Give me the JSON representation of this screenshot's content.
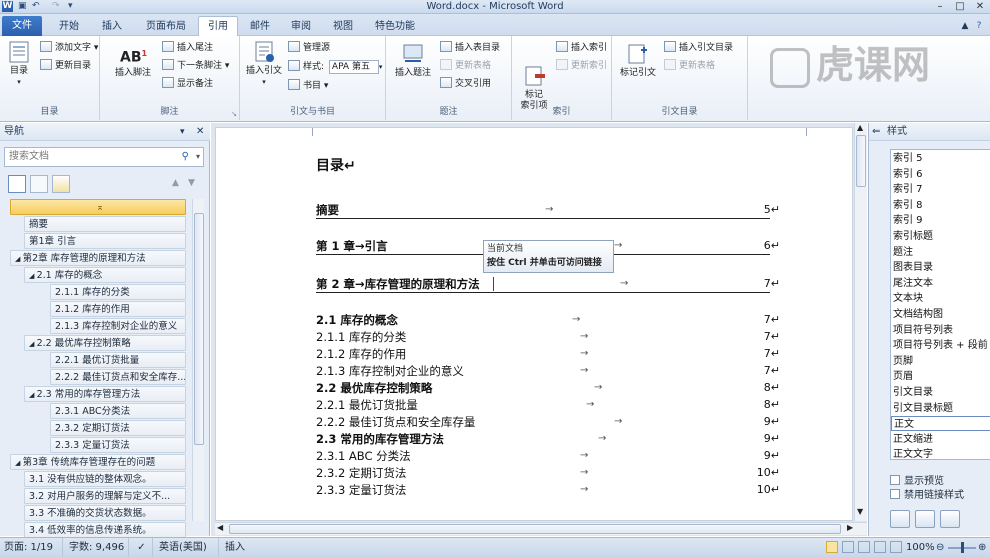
{
  "window": {
    "title": "Word.docx - Microsoft Word",
    "app_icon": "W",
    "quick_access": [
      "save-icon",
      "undo-icon",
      "redo-icon",
      "customize-icon"
    ]
  },
  "tabs": [
    "文件",
    "开始",
    "插入",
    "页面布局",
    "引用",
    "邮件",
    "审阅",
    "视图",
    "特色功能"
  ],
  "ribbon": {
    "toc": {
      "big": "目录",
      "add_text": "添加文字",
      "update": "更新目录",
      "group": "目录"
    },
    "footnote": {
      "big": "插入脚注",
      "insert_endnote": "插入尾注",
      "next_footnote": "下一条脚注",
      "show_notes": "显示备注",
      "group": "脚注"
    },
    "citation": {
      "big": "插入引文",
      "manage_sources": "管理源",
      "style_label": "样式:",
      "style_value": "APA 第五",
      "bibliography": "书目",
      "group": "引文与书目"
    },
    "caption": {
      "big": "插入题注",
      "insert_table_of_figures": "插入表目录",
      "update_table": "更新表格",
      "cross_reference": "交叉引用",
      "group": "题注"
    },
    "index": {
      "big": "标记\n索引项",
      "insert_index": "插入索引",
      "update_index": "更新索引",
      "group": "索引"
    },
    "toa": {
      "big": "标记引文",
      "insert_toa": "插入引文目录",
      "update_table": "更新表格",
      "group": "引文目录"
    }
  },
  "watermark": "虎课网",
  "nav": {
    "title": "导航",
    "search_placeholder": "搜索文档",
    "items": [
      {
        "label": "",
        "level": 0,
        "selected": true
      },
      {
        "label": "摘要",
        "level": 1
      },
      {
        "label": "第1章 引言",
        "level": 1
      },
      {
        "label": "第2章 库存管理的原理和方法",
        "level": 0,
        "expanded": true
      },
      {
        "label": "2.1 库存的概念",
        "level": 1,
        "expanded": true
      },
      {
        "label": "2.1.1 库存的分类",
        "level": 2
      },
      {
        "label": "2.1.2 库存的作用",
        "level": 2
      },
      {
        "label": "2.1.3 库存控制对企业的意义",
        "level": 2
      },
      {
        "label": "2.2 最优库存控制策略",
        "level": 1,
        "expanded": true
      },
      {
        "label": "2.2.1 最优订货批量",
        "level": 2
      },
      {
        "label": "2.2.2 最佳订货点和安全库存...",
        "level": 2
      },
      {
        "label": "2.3 常用的库存管理方法",
        "level": 1,
        "expanded": true
      },
      {
        "label": "2.3.1 ABC分类法",
        "level": 2
      },
      {
        "label": "2.3.2 定期订货法",
        "level": 2
      },
      {
        "label": "2.3.3 定量订货法",
        "level": 2
      },
      {
        "label": "第3章 传统库存管理存在的问题",
        "level": 0,
        "expanded": true
      },
      {
        "label": "3.1 没有供应链的整体观念。",
        "level": 1
      },
      {
        "label": "3.2 对用户服务的理解与定义不...",
        "level": 1
      },
      {
        "label": "3.3 不准确的交货状态数据。",
        "level": 1
      },
      {
        "label": "3.4 低效率的信息传递系统。",
        "level": 1
      }
    ]
  },
  "document": {
    "heading": "目录↵",
    "entries": [
      {
        "text": "摘要",
        "page": "5↵",
        "style": "h1"
      },
      {
        "text": "第 1 章→引言",
        "page": "6↵",
        "style": "h1"
      },
      {
        "text": "第 2 章→库存管理的原理和方法",
        "page": "7↵",
        "style": "h1"
      },
      {
        "text": "2.1  库存的概念",
        "page": "7↵",
        "style": "h2"
      },
      {
        "text": "2.1.1  库存的分类",
        "page": "7↵",
        "style": "h3"
      },
      {
        "text": "2.1.2  库存的作用",
        "page": "7↵",
        "style": "h3"
      },
      {
        "text": "2.1.3  库存控制对企业的意义",
        "page": "7↵",
        "style": "h3"
      },
      {
        "text": "2.2  最优库存控制策略",
        "page": "8↵",
        "style": "h2"
      },
      {
        "text": "2.2.1  最优订货批量",
        "page": "8↵",
        "style": "h3"
      },
      {
        "text": "2.2.2  最佳订货点和安全库存量",
        "page": "9↵",
        "style": "h3"
      },
      {
        "text": "2.3  常用的库存管理方法",
        "page": "9↵",
        "style": "h2"
      },
      {
        "text": "2.3.1 ABC 分类法",
        "page": "9↵",
        "style": "h3"
      },
      {
        "text": "2.3.2  定期订货法",
        "page": "10↵",
        "style": "h3"
      },
      {
        "text": "2.3.3  定量订货法",
        "page": "10↵",
        "style": "h3"
      }
    ],
    "tooltip": {
      "line1": "当前文档",
      "line2": "按住 Ctrl 并单击可访问链接"
    }
  },
  "styles_pane": {
    "title": "样式",
    "items": [
      "索引 5",
      "索引 6",
      "索引 7",
      "索引 8",
      "索引 9",
      "索引标题",
      "题注",
      "图表目录",
      "尾注文本",
      "文本块",
      "文档结构图",
      "项目符号列表",
      "项目符号列表 + 段前",
      "页脚",
      "页眉",
      "引文目录",
      "引文目录标题",
      "正文",
      "正文缩进",
      "正文文字"
    ],
    "selected": "正文",
    "show_preview": "显示预览",
    "disable_linked": "禁用链接样式"
  },
  "statusbar": {
    "page": "页面: 1/19",
    "words": "字数: 9,496",
    "language": "英语(美国)",
    "mode": "插入",
    "zoom": "100%"
  },
  "colors": {
    "accent": "#2a5fad",
    "nav_selected": "#f6cd5e"
  }
}
